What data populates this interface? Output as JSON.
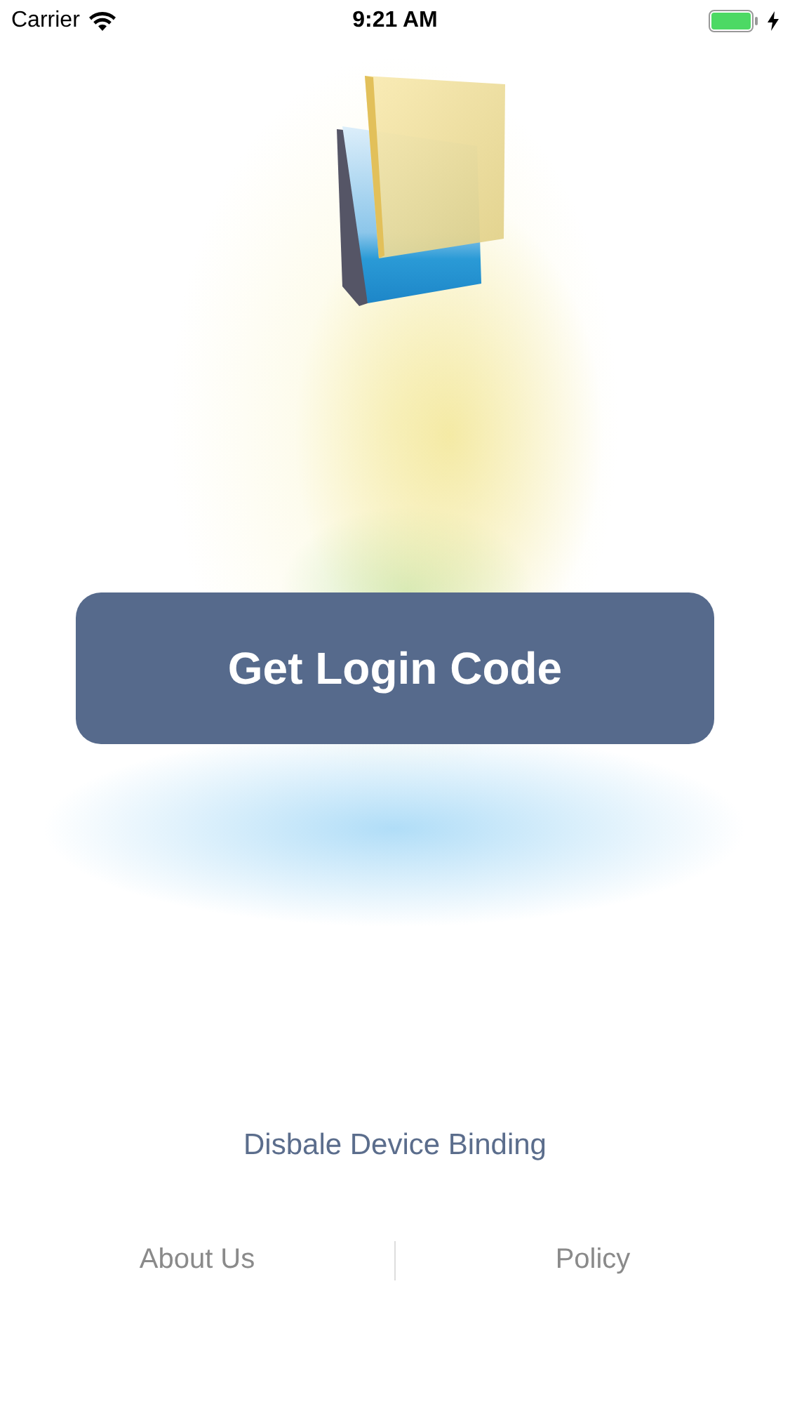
{
  "status_bar": {
    "carrier": "Carrier",
    "time": "9:21 AM"
  },
  "login_button": {
    "label": "Get Login Code"
  },
  "disable_binding_link": {
    "label": "Disbale Device Binding"
  },
  "footer_links": [
    {
      "label": "About Us"
    },
    {
      "label": "Policy"
    }
  ]
}
